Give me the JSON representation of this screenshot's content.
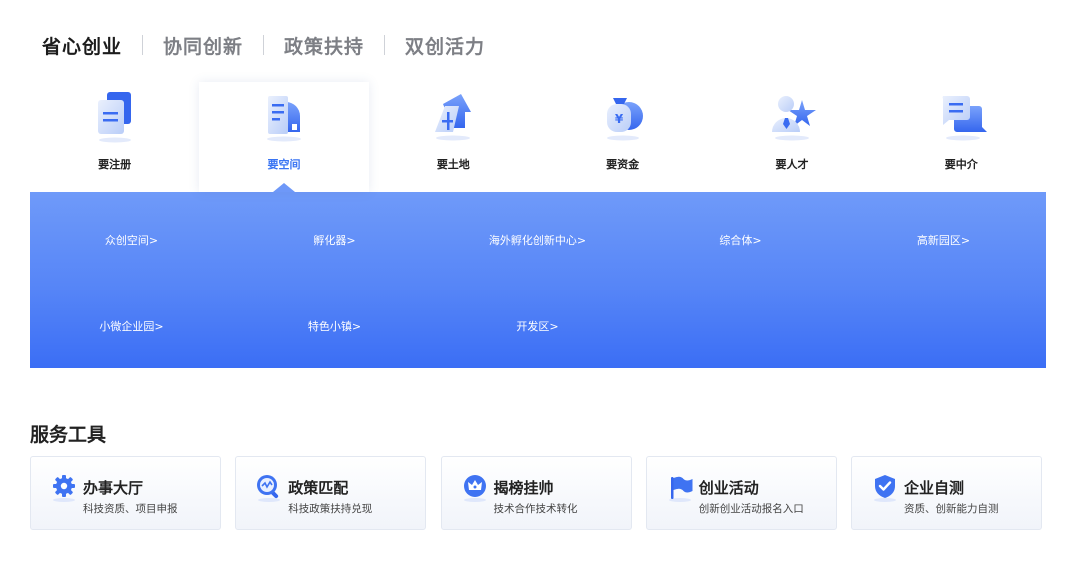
{
  "top_tabs": [
    "省心创业",
    "协同创新",
    "政策扶持",
    "双创活力"
  ],
  "categories": [
    {
      "label": "要注册",
      "icon": "document-icon"
    },
    {
      "label": "要空间",
      "icon": "building-icon"
    },
    {
      "label": "要土地",
      "icon": "land-icon"
    },
    {
      "label": "要资金",
      "icon": "money-bag-icon"
    },
    {
      "label": "要人才",
      "icon": "talent-icon"
    },
    {
      "label": "要中介",
      "icon": "chat-icon"
    }
  ],
  "space_links": [
    "众创空间>",
    "孵化器>",
    "海外孵化创新中心>",
    "综合体>",
    "高新园区>",
    "小微企业园>",
    "特色小镇>",
    "开发区>"
  ],
  "services": {
    "title": "服务工具",
    "items": [
      {
        "name": "办事大厅",
        "desc": "科技资质、项目申报",
        "icon": "gear-icon"
      },
      {
        "name": "政策匹配",
        "desc": "科技政策扶持兑现",
        "icon": "search-icon"
      },
      {
        "name": "揭榜挂帅",
        "desc": "技术合作技术转化",
        "icon": "crown-icon"
      },
      {
        "name": "创业活动",
        "desc": "创新创业活动报名入口",
        "icon": "flag-icon"
      },
      {
        "name": "企业自测",
        "desc": "资质、创新能力自测",
        "icon": "shield-check-icon"
      }
    ]
  },
  "colors": {
    "accent": "#3974f3",
    "panel_top": "#6f9af9",
    "panel_bottom": "#3b6ef5"
  }
}
